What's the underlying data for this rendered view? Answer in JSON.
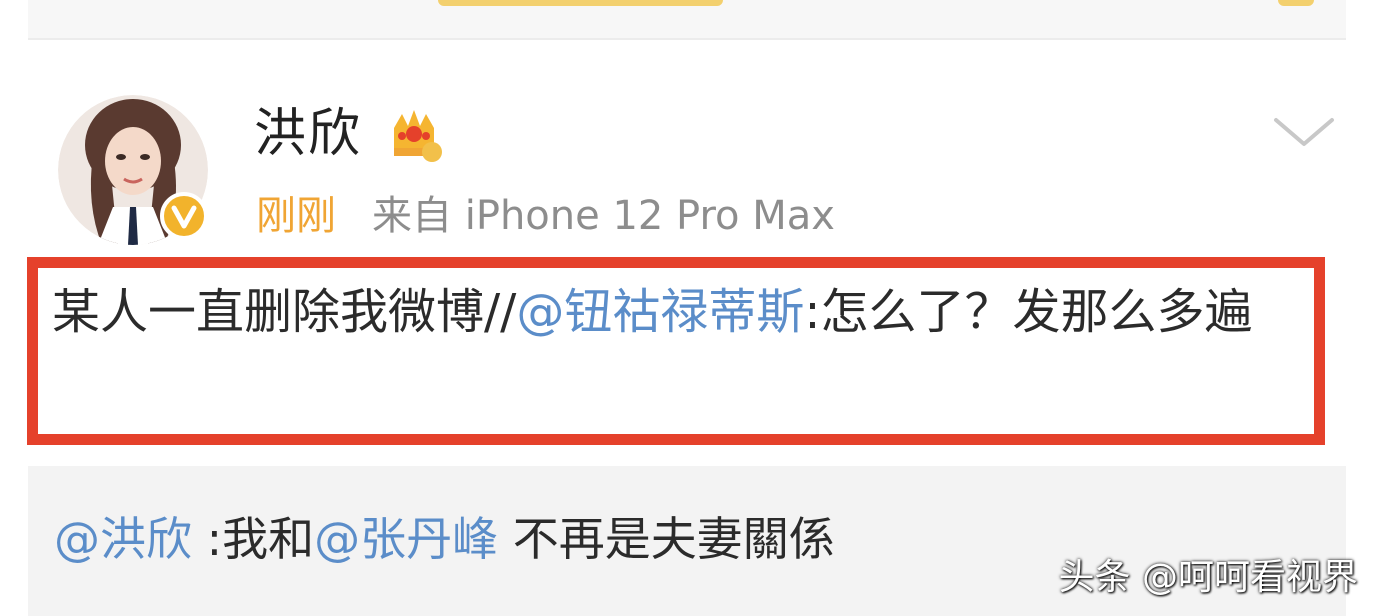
{
  "post": {
    "username": "洪欣",
    "time": "刚刚",
    "source": "来自 iPhone 12 Pro Max",
    "text_main": "某人一直删除我微博//",
    "mention": "@钮祜禄蒂斯",
    "text_tail": ":怎么了？发那么多遍"
  },
  "repost": {
    "mention1": "@洪欣",
    "text1": " :我和",
    "mention2": "@张丹峰",
    "text2": " 不再是夫妻關係"
  },
  "watermark": "头条 @呵呵看视界",
  "colors": {
    "highlight_border": "#e5412b",
    "mention": "#5b8dc9",
    "time": "#f0a534",
    "verified": "#f2b32c"
  },
  "icons": {
    "crown": "crown-icon",
    "verified": "verified-icon",
    "chevron": "chevron-down-icon"
  }
}
